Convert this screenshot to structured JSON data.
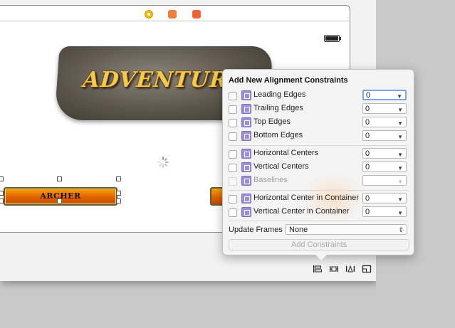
{
  "scene": {
    "logo_text": "ADVENTURE",
    "button_label": "ARCHER"
  },
  "popover": {
    "title": "Add New Alignment Constraints",
    "rows": [
      {
        "label": "Leading Edges",
        "value": "0",
        "enabled": true
      },
      {
        "label": "Trailing Edges",
        "value": "0",
        "enabled": true
      },
      {
        "label": "Top Edges",
        "value": "0",
        "enabled": true
      },
      {
        "label": "Bottom Edges",
        "value": "0",
        "enabled": true
      },
      {
        "label": "Horizontal Centers",
        "value": "0",
        "enabled": true
      },
      {
        "label": "Vertical Centers",
        "value": "0",
        "enabled": true
      },
      {
        "label": "Baselines",
        "value": "",
        "enabled": false
      },
      {
        "label": "Horizontal Center in Container",
        "value": "0",
        "enabled": true
      },
      {
        "label": "Vertical Center in Container",
        "value": "0",
        "enabled": true
      }
    ],
    "update_frames_label": "Update Frames",
    "update_frames_value": "None",
    "add_button_label": "Add Constraints"
  },
  "colors": {
    "accent": "#7aa6e6",
    "constraint_icon": "#9a8fd9",
    "button_orange": "#e06300"
  },
  "icons": [
    "first-responder-icon",
    "view-controller-icon",
    "exit-icon",
    "align-icon",
    "pin-icon",
    "resolve-icon",
    "resizing-icon",
    "battery-icon",
    "spinner-icon"
  ]
}
